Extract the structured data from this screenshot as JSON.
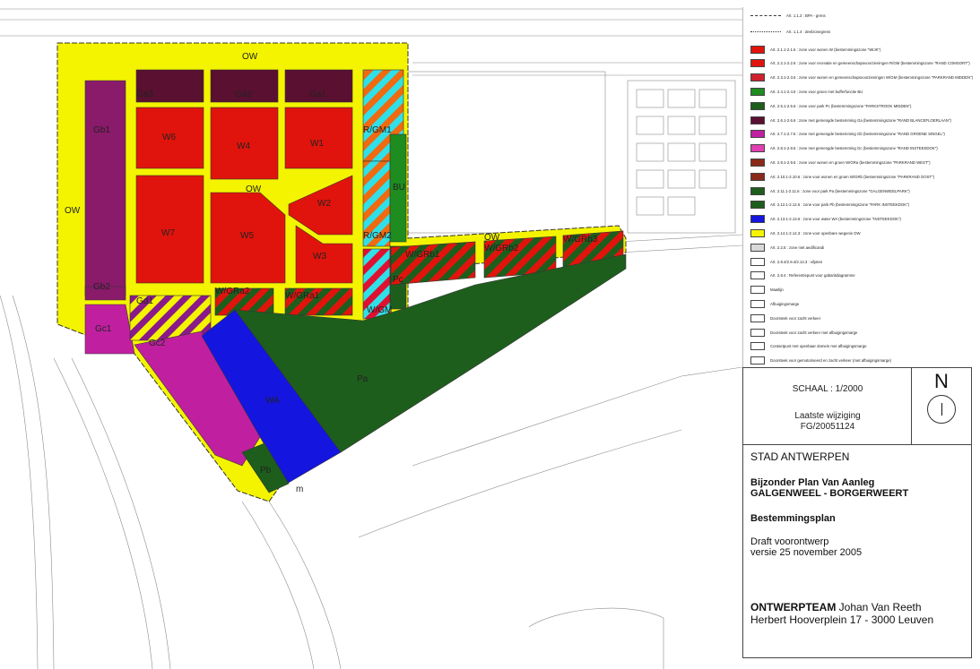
{
  "map": {
    "zones": [
      {
        "id": "OW-top",
        "label": "OW"
      },
      {
        "id": "OW-left",
        "label": "OW"
      },
      {
        "id": "OW-center",
        "label": "OW"
      },
      {
        "id": "OW-right",
        "label": "OW"
      },
      {
        "id": "W1",
        "label": "W1"
      },
      {
        "id": "W2",
        "label": "W2"
      },
      {
        "id": "W3",
        "label": "W3"
      },
      {
        "id": "W4",
        "label": "W4"
      },
      {
        "id": "W5",
        "label": "W5"
      },
      {
        "id": "W6",
        "label": "W6"
      },
      {
        "id": "W7",
        "label": "W7"
      },
      {
        "id": "Ga1",
        "label": "Ga1"
      },
      {
        "id": "Ga2",
        "label": "Ga2"
      },
      {
        "id": "Ga3",
        "label": "Ga3"
      },
      {
        "id": "Gb1",
        "label": "Gb1"
      },
      {
        "id": "Gb2",
        "label": "Gb2"
      },
      {
        "id": "Gc1",
        "label": "Gc1"
      },
      {
        "id": "Gc2",
        "label": "Gc2"
      },
      {
        "id": "Gd1",
        "label": "Gd1"
      },
      {
        "id": "RGM1",
        "label": "R/GM1"
      },
      {
        "id": "RGM2",
        "label": "R/GM2"
      },
      {
        "id": "WGM",
        "label": "W/GM"
      },
      {
        "id": "BU",
        "label": "BU"
      },
      {
        "id": "Pc",
        "label": "Pc"
      },
      {
        "id": "WGRa1",
        "label": "W/GRa1"
      },
      {
        "id": "WGRa2",
        "label": "W/GRa2"
      },
      {
        "id": "WGRb1",
        "label": "W/GRb1"
      },
      {
        "id": "WGRb2",
        "label": "W/GRb2"
      },
      {
        "id": "WGRb3",
        "label": "W/GRb3"
      },
      {
        "id": "WA",
        "label": "WA"
      },
      {
        "id": "Pa",
        "label": "Pa"
      },
      {
        "id": "Pb",
        "label": "Pb"
      },
      {
        "id": "m",
        "label": "m"
      }
    ]
  },
  "legend": {
    "lines": [
      {
        "text": "Art. 1.1.2 : BPA - grens"
      },
      {
        "text": "Art. 1.1.4 : deelzonegrens"
      }
    ],
    "items": [
      {
        "color": "#e0140c",
        "text": "Art. 2.1.1-2.1.6 : zone voor wonen W (bestemmingszone \"WIJK\")"
      },
      {
        "color": "#e0140c",
        "text": "Art. 2.2.1-2.2.6 : zone voor recreatie en gemeenschapsvoorzieningen R/GM (bestemmingszone \"RAND COMSORT\")"
      },
      {
        "color": "#d02030",
        "text": "Art. 2.3.1-2.3.6 : zone voor wonen en gemeenschapsvoorzieningen W/GM (bestemmingszone \"PARKRAND MIDDEN\")"
      },
      {
        "color": "#1e8c1e",
        "text": "Art. 2.4.1-2.4.6 : zone voor groen met bufferfunctie BU"
      },
      {
        "color": "#1d5e1d",
        "text": "Art. 2.5.1-2.5.6 : zone voor park Pc (bestemmingszone \"PARKSTROOK MIDDEN\")"
      },
      {
        "color": "#5a1030",
        "text": "Art. 2.6.1-2.6.6 : zone met gemengde bestemming Ga (bestemmingszone \"RAND BLANCEFLOERLAAN\")"
      },
      {
        "color": "#c020a0",
        "text": "Art. 2.7.1-2.7.6 : zone met gemengde bestemming Gb (bestemmingszone \"RAND GROENE SINGEL\")"
      },
      {
        "color": "#e040b0",
        "text": "Art. 2.8.1-2.8.6 : zone met gemengde bestemming Gc (bestemmingszone \"RAND INSTEEKDOK\")"
      },
      {
        "color": "#8a2a1a",
        "text": "Art. 2.9.1-2.9.6 : zone voor wonen en groen W/GRa (bestemmingszone \"PARKRAND WEST\")"
      },
      {
        "color": "#8a2a1a",
        "text": "Art. 2.10.1-2.10.6 : zone voor wonen en groen W/GRb (bestemmingszone \"PARKRAND OOST\")"
      },
      {
        "color": "#1d5e1d",
        "text": "Art. 2.11.1-2.11.6 : zone voor park Pa (bestemmingszone \"GALGENWEELPARK\")"
      },
      {
        "color": "#1d5e1d",
        "text": "Art. 2.12.1-2.12.6 : zone voor park Pb (bestemmingszone \"PARK INSTEEKDOK\")"
      },
      {
        "color": "#1515e0",
        "text": "Art. 2.13.1-2.13.6 : zone voor water WA (bestemmingszone \"INSTEEKDOK\")"
      },
      {
        "color": "#f4f400",
        "text": "Art. 2.14.1-2.14.3 : zone voor openbare wegenis OW"
      },
      {
        "color": "#d8d8d8",
        "text": "Art. 2.2.5 : zone niet aedificandi"
      },
      {
        "color": "#ffffff",
        "text": "Art. 2.8.4/2.9.4/2.14.3 : viljoten"
      },
      {
        "color": "#ffffff",
        "text": "Art. 2.8.4 : Referentiepunt voor gabaritdiagramme"
      },
      {
        "color": "#ffffff",
        "text": "Maatlijn"
      },
      {
        "color": "#ffffff",
        "text": "Afbuigingsmarge"
      },
      {
        "color": "#ffffff",
        "text": "Doorsteek voor zacht verkeer"
      },
      {
        "color": "#ffffff",
        "text": "Doorsteek voor zacht verkeer met afbuigingsmarge"
      },
      {
        "color": "#ffffff",
        "text": "Contactpunt met openbaar domein met afbuigingsmarge"
      },
      {
        "color": "#ffffff",
        "text": "Doorsteek voor gemotoriseerd en zacht verkeer (met afbuigingsmarge)"
      }
    ]
  },
  "title_block": {
    "scale": "SCHAAL : 1/2000",
    "north": "N",
    "modification_label": "Laatste wijziging",
    "modification_code": "FG/20051124",
    "city": "STAD ANTWERPEN",
    "plan_line1": "Bijzonder Plan Van Aanleg",
    "plan_line2": "GALGENWEEL - BORGERWEERT",
    "plan_type": "Bestemmingsplan",
    "draft": "Draft voorontwerp",
    "version": "versie 25 november 2005",
    "team_bold": "ONTWERPTEAM",
    "team_name": " Johan Van Reeth",
    "address": "Herbert Hooverplein 17 - 3000 Leuven"
  }
}
